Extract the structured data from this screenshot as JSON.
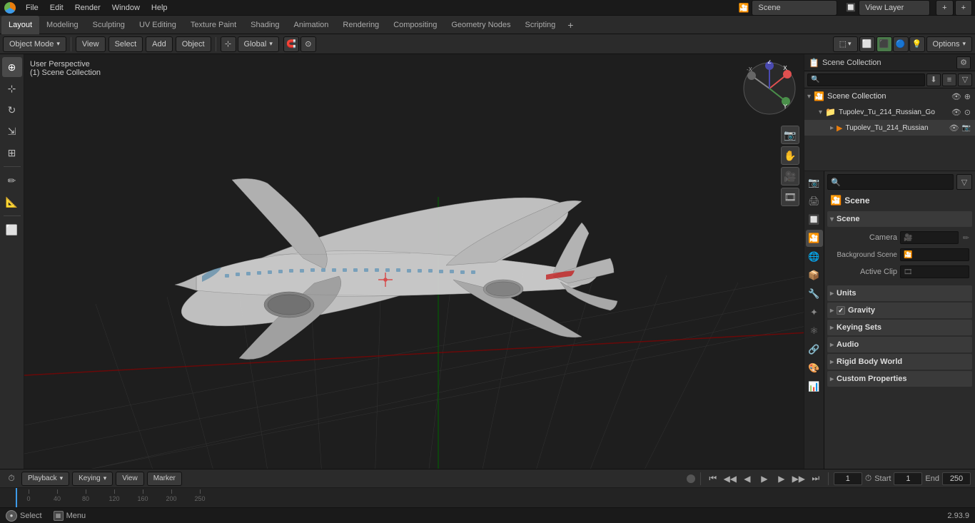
{
  "app": {
    "version": "2.93.9"
  },
  "top_menu": {
    "items": [
      "Blender",
      "File",
      "Edit",
      "Render",
      "Window",
      "Help"
    ]
  },
  "workspace_tabs": {
    "items": [
      "Layout",
      "Modeling",
      "Sculpting",
      "UV Editing",
      "Texture Paint",
      "Shading",
      "Animation",
      "Rendering",
      "Compositing",
      "Geometry Nodes",
      "Scripting"
    ],
    "active": "Layout"
  },
  "viewport_toolbar": {
    "mode_label": "Object Mode",
    "view_label": "View",
    "select_label": "Select",
    "add_label": "Add",
    "object_label": "Object",
    "transform_label": "Global",
    "pivot_label": "Individual Origins"
  },
  "viewport": {
    "info_line1": "User Perspective",
    "info_line2": "(1) Scene Collection"
  },
  "outliner": {
    "title": "Scene Collection",
    "search_placeholder": "",
    "items": [
      {
        "name": "Tupolev_Tu_214_Russian_Go",
        "icon": "📁",
        "depth": 0,
        "expanded": true
      },
      {
        "name": "Tupolev_Tu_214_Russian",
        "icon": "▶",
        "depth": 1
      }
    ]
  },
  "properties": {
    "panel_title": "Scene",
    "scene_section": {
      "title": "Scene",
      "camera_label": "Camera",
      "background_scene_label": "Background Scene",
      "active_clip_label": "Active Clip"
    },
    "units_section": "Units",
    "gravity_section": "Gravity",
    "keying_sets_section": "Keying Sets",
    "audio_section": "Audio",
    "rigid_body_world_section": "Rigid Body World",
    "custom_properties_section": "Custom Properties"
  },
  "timeline": {
    "playback_label": "Playback",
    "keying_label": "Keying",
    "view_label": "View",
    "marker_label": "Marker",
    "start_label": "Start",
    "end_label": "End",
    "start_value": "1",
    "end_value": "250",
    "current_frame": "1",
    "frame_markers": [
      "0",
      "40",
      "80",
      "120",
      "160",
      "200",
      "250"
    ],
    "ruler_frames": [
      0,
      40,
      80,
      120,
      160,
      200,
      250
    ]
  },
  "status_bar": {
    "select_label": "Select",
    "version": "2.93.9"
  },
  "icons": {
    "cursor": "⊕",
    "move": "⊹",
    "rotate": "↺",
    "scale": "⇲",
    "transform": "⊞",
    "annotate": "✏",
    "measure": "📐",
    "add_cube": "⬜",
    "scene_icon": "🎬",
    "render_icon": "📷",
    "output_icon": "🖨",
    "view_layer_icon": "🔲",
    "scene_prop_icon": "🎦",
    "world_icon": "🌐",
    "object_icon": "📦",
    "modifier_icon": "🔧",
    "particles_icon": "✦",
    "physics_icon": "⚛",
    "constraint_icon": "🔗",
    "material_icon": "🎨",
    "data_icon": "📊"
  }
}
